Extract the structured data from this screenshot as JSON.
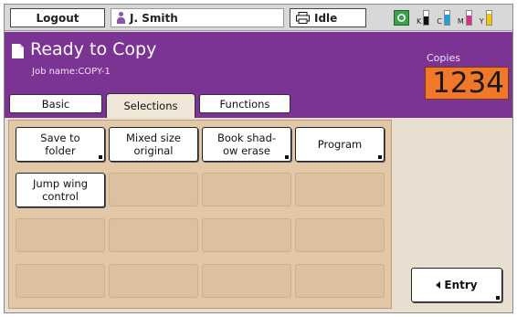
{
  "topbar": {
    "logout_label": "Logout",
    "user_name": "J. Smith",
    "status_label": "Idle",
    "toner": [
      {
        "label": "K",
        "color": "#111111",
        "level": 0.6
      },
      {
        "label": "C",
        "color": "#1aa3d9",
        "level": 0.75
      },
      {
        "label": "M",
        "color": "#d6308a",
        "level": 0.7
      },
      {
        "label": "Y",
        "color": "#f2c500",
        "level": 0.8
      }
    ]
  },
  "header": {
    "title": "Ready to Copy",
    "job_name": "Job name:COPY-1",
    "copies_label": "Copies",
    "copies_value": "1234"
  },
  "tabs": [
    {
      "label": "Basic",
      "active": false
    },
    {
      "label": "Selections",
      "active": true
    },
    {
      "label": "Functions",
      "active": false
    }
  ],
  "functions": [
    {
      "line1": "Save to",
      "line2": "folder"
    },
    {
      "line1": "Mixed size",
      "line2": "original"
    },
    {
      "line1": "Book shad-",
      "line2": "ow erase"
    },
    {
      "line1": "Program",
      "line2": ""
    },
    {
      "line1": "Jump wing",
      "line2": "control"
    }
  ],
  "entry_label": "Entry",
  "colors": {
    "header_purple": "#7c3494",
    "copies_orange": "#f07828",
    "panel_tan": "#e2c8a6"
  }
}
